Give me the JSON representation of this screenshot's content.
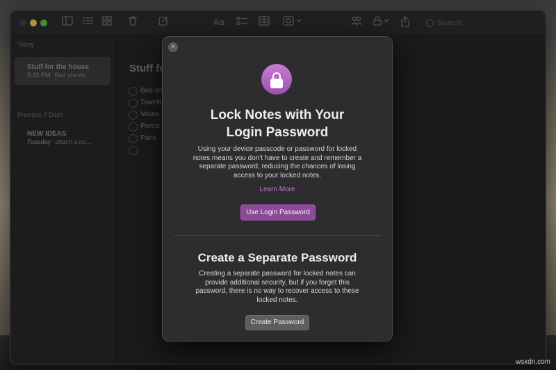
{
  "sidebar": {
    "section_today": "Today",
    "section_previous": "Previous 7 Days",
    "notes": [
      {
        "title": "Stuff for the house",
        "time": "5:22 PM",
        "preview": "Bed sheets"
      },
      {
        "title": "NEW IDEAS",
        "time": "Tuesday",
        "preview": "attach a no..."
      }
    ]
  },
  "toolbar": {
    "search_placeholder": "Search",
    "icons": [
      "sidebar-icon",
      "list-icon",
      "gallery-icon",
      "trash-icon",
      "compose-icon",
      "format-icon",
      "checklist-icon",
      "table-icon",
      "media-icon",
      "collaborate-icon",
      "lock-icon",
      "share-icon",
      "search-icon"
    ],
    "format_label": "Aa"
  },
  "editor": {
    "title": "Stuff fo",
    "items": [
      "Bed sh",
      "Towels",
      "Vases",
      "Portra",
      "Pans",
      ""
    ]
  },
  "dialog": {
    "title": "Lock Notes with Your Login Password",
    "title_line1": "Lock Notes with Your",
    "title_line2": "Login Password",
    "body1_l1": "Using your device passcode or password for locked",
    "body1_l2": "notes means you don't have to create and remember a",
    "body1_l3": "separate password, reducing the chances of losing",
    "body1_l4": "access to your locked notes.",
    "learn_more": "Learn More",
    "primary_button": "Use Login Password",
    "subtitle": "Create a Separate Password",
    "body2_l1": "Creating a separate password for locked notes can",
    "body2_l2": "provide additional security, but if you forget this",
    "body2_l3": "password, there is no way to recover access to these",
    "body2_l4": "locked notes.",
    "secondary_button": "Create Password",
    "close_glyph": "×"
  },
  "colors": {
    "accent_purple": "#8c4a98",
    "link_purple": "#c17fce"
  },
  "watermark": "wsxdn.com"
}
